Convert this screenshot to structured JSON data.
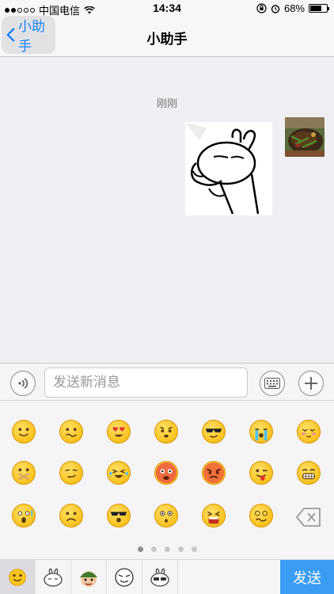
{
  "status_bar": {
    "carrier": "中国电信",
    "time": "14:34",
    "battery_text": "68%",
    "battery_level": 0.68
  },
  "nav": {
    "back_label": "小助手",
    "title": "小助手"
  },
  "chat": {
    "timestamp": "刚刚"
  },
  "input": {
    "placeholder": "发送新消息"
  },
  "emoji_pages": {
    "total": 5,
    "active": 0
  },
  "tabs": {
    "send_label": "发送"
  },
  "colors": {
    "accent": "#1a82f7",
    "send_bg": "#3a9cf2"
  }
}
